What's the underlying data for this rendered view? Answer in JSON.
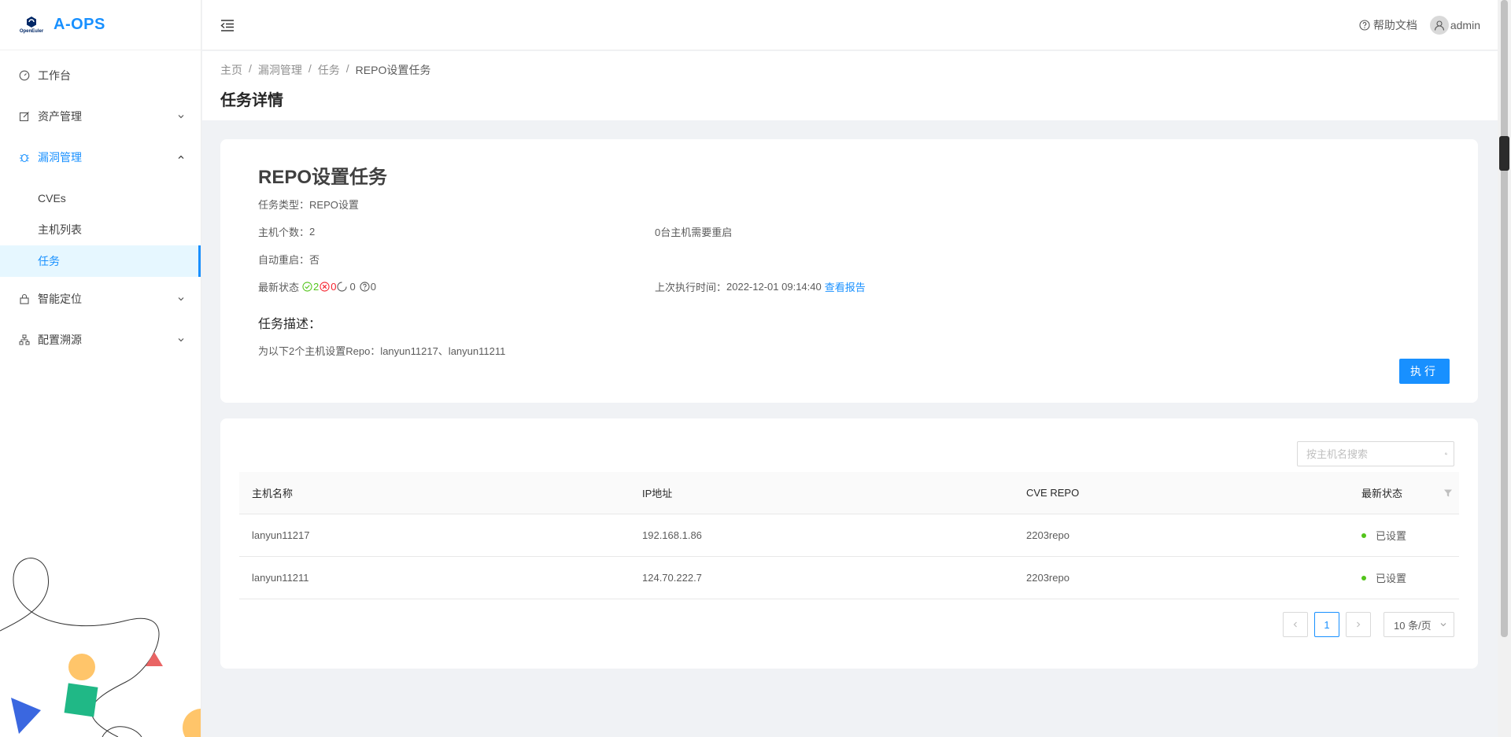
{
  "app": {
    "brand": "A-OPS",
    "logo_sub": "OpenEuler",
    "brand_color": "#1890ff"
  },
  "sidebar": {
    "items": [
      {
        "label": "工作台",
        "icon": "dashboard-icon"
      },
      {
        "label": "资产管理",
        "icon": "edit-icon"
      },
      {
        "label": "漏洞管理",
        "icon": "bug-icon"
      },
      {
        "label": "智能定位",
        "icon": "lock-icon"
      },
      {
        "label": "配置溯源",
        "icon": "cluster-icon"
      }
    ],
    "sub_items": [
      "CVEs",
      "主机列表",
      "任务"
    ]
  },
  "header": {
    "help_label": "帮助文档",
    "user_name": "admin"
  },
  "breadcrumb": [
    "主页",
    "漏洞管理",
    "任务",
    "REPO设置任务"
  ],
  "page_title": "任务详情",
  "task": {
    "name": "REPO设置任务",
    "type_label": "任务类型：",
    "type_value": "REPO设置",
    "host_count_label": "主机个数：",
    "host_count_value": "2",
    "reboot_needed": "0台主机需要重启",
    "auto_reboot_label": "自动重启：",
    "auto_reboot_value": "否",
    "status_label": "最新状态",
    "status_success": "2",
    "status_fail": "0",
    "status_running": "0",
    "status_unknown": "0",
    "last_exec_label": "上次执行时间：",
    "last_exec_value": "2022-12-01 09:14:40",
    "report_link": "查看报告",
    "desc_title": "任务描述：",
    "desc_text": "为以下2个主机设置Repo：lanyun11217、lanyun11211",
    "exec_button": "执行"
  },
  "search": {
    "placeholder": "按主机名搜索"
  },
  "table": {
    "headers": [
      "主机名称",
      "IP地址",
      "CVE REPO",
      "最新状态"
    ],
    "rows": [
      {
        "host": "lanyun11217",
        "ip": "192.168.1.86",
        "repo": "2203repo",
        "status": "已设置"
      },
      {
        "host": "lanyun11211",
        "ip": "124.70.222.7",
        "repo": "2203repo",
        "status": "已设置"
      }
    ]
  },
  "pagination": {
    "current": "1",
    "page_size": "10 条/页"
  },
  "colors": {
    "success": "#52c41a",
    "fail": "#f5222d",
    "accent": "#1890ff"
  }
}
